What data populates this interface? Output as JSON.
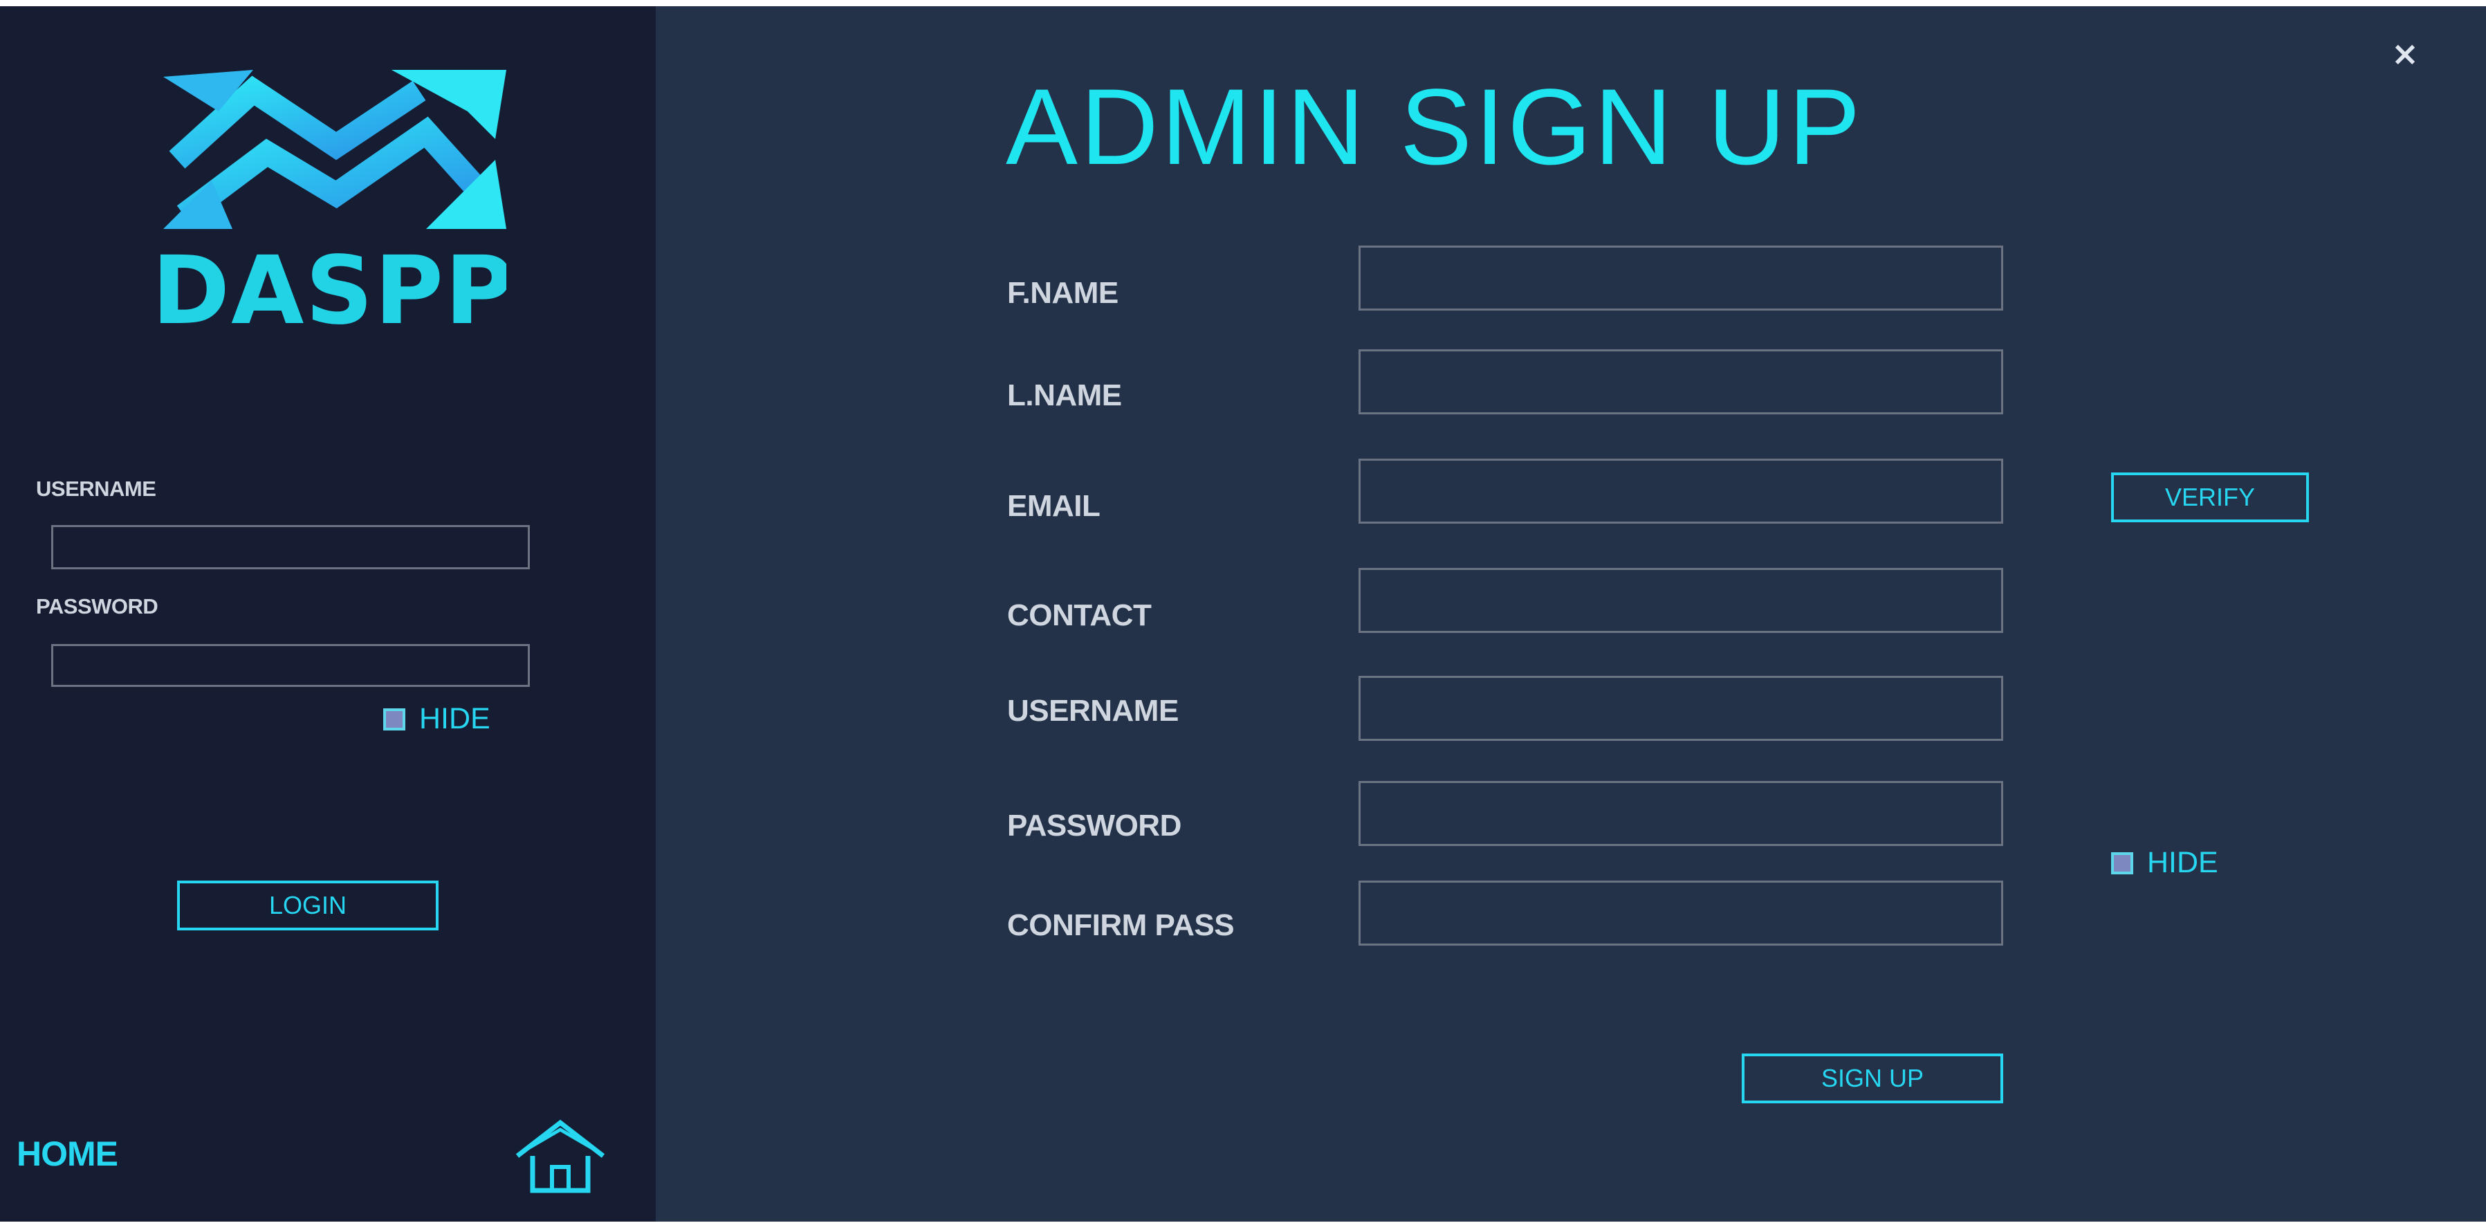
{
  "sidebar": {
    "logo_text": "DASPP",
    "username_label": "USERNAME",
    "username_value": "",
    "password_label": "PASSWORD",
    "password_value": "",
    "hide_label": "HIDE",
    "login_label": "LOGIN",
    "home_label": "HOME"
  },
  "main": {
    "title": "ADMIN SIGN UP",
    "close_glyph": "×",
    "fields": [
      {
        "label": "F.NAME",
        "value": ""
      },
      {
        "label": "L.NAME",
        "value": ""
      },
      {
        "label": "EMAIL",
        "value": ""
      },
      {
        "label": "CONTACT",
        "value": ""
      },
      {
        "label": "USERNAME",
        "value": ""
      },
      {
        "label": "PASSWORD",
        "value": ""
      },
      {
        "label": "CONFIRM PASS",
        "value": ""
      }
    ],
    "verify_label": "VERIFY",
    "hide_label": "HIDE",
    "signup_label": "SIGN UP"
  },
  "colors": {
    "sidebar_bg": "#161d33",
    "main_bg": "#243249",
    "accent": "#27d6f0",
    "label_text": "#cfd6df"
  },
  "icons": {
    "logo": "daspp-arrows-logo",
    "home": "home-icon",
    "close": "close-icon"
  }
}
